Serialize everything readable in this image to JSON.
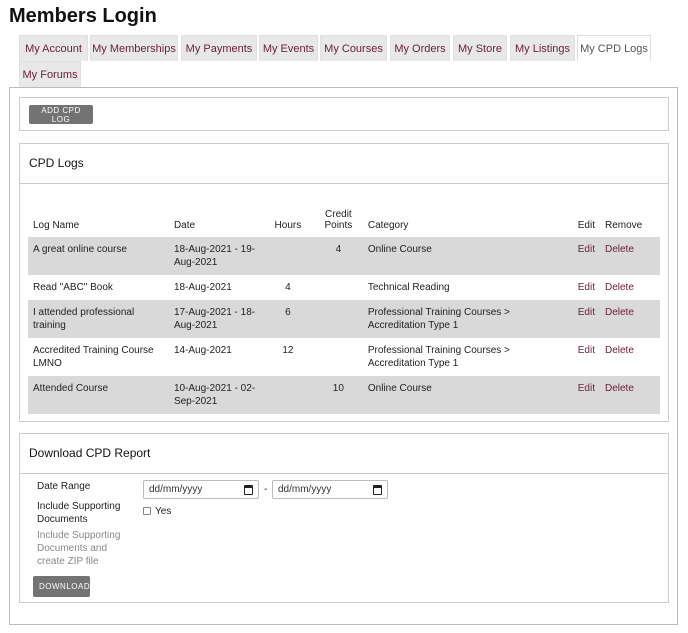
{
  "page": {
    "title": "Members Login"
  },
  "tabs": [
    {
      "label": "My Account"
    },
    {
      "label": "My Memberships"
    },
    {
      "label": "My Payments"
    },
    {
      "label": "My Events"
    },
    {
      "label": "My Courses"
    },
    {
      "label": "My Orders"
    },
    {
      "label": "My Store"
    },
    {
      "label": "My Listings"
    },
    {
      "label": "My CPD Logs"
    },
    {
      "label": "My Forums"
    }
  ],
  "add_button": {
    "label": "ADD CPD LOG"
  },
  "logs": {
    "title": "CPD Logs",
    "columns": {
      "name": "Log Name",
      "date": "Date",
      "hours": "Hours",
      "credit_line1": "Credit",
      "credit_line2": "Points",
      "category": "Category",
      "edit": "Edit",
      "remove": "Remove"
    },
    "rows": [
      {
        "name": "A great online course",
        "date": "18-Aug-2021 - 19-Aug-2021",
        "hours": "",
        "points": "4",
        "category": "Online Course",
        "edit": "Edit",
        "delete": "Delete"
      },
      {
        "name": "Read \"ABC\" Book",
        "date": "18-Aug-2021",
        "hours": "4",
        "points": "",
        "category": "Technical Reading",
        "edit": "Edit",
        "delete": "Delete"
      },
      {
        "name": "I attended professional training",
        "date": "17-Aug-2021 - 18-Aug-2021",
        "hours": "6",
        "points": "",
        "category": "Professional Training Courses > Accreditation Type 1",
        "edit": "Edit",
        "delete": "Delete"
      },
      {
        "name": "Accredited Training Course LMNO",
        "date": "14-Aug-2021",
        "hours": "12",
        "points": "",
        "category": "Professional Training Courses > Accreditation Type 1",
        "edit": "Edit",
        "delete": "Delete"
      },
      {
        "name": "Attended Course",
        "date": "10-Aug-2021 - 02-Sep-2021",
        "hours": "",
        "points": "10",
        "category": "Online Course",
        "edit": "Edit",
        "delete": "Delete"
      }
    ]
  },
  "report": {
    "title": "Download CPD Report",
    "date_range_label": "Date Range",
    "start_placeholder": "dd/mm/yyyy",
    "separator": "-",
    "end_placeholder": "dd/mm/yyyy",
    "include_label": "Include Supporting Documents",
    "include_help": "Include Supporting Documents and create ZIP file",
    "yes_label": "Yes",
    "download_label": "DOWNLOAD"
  }
}
